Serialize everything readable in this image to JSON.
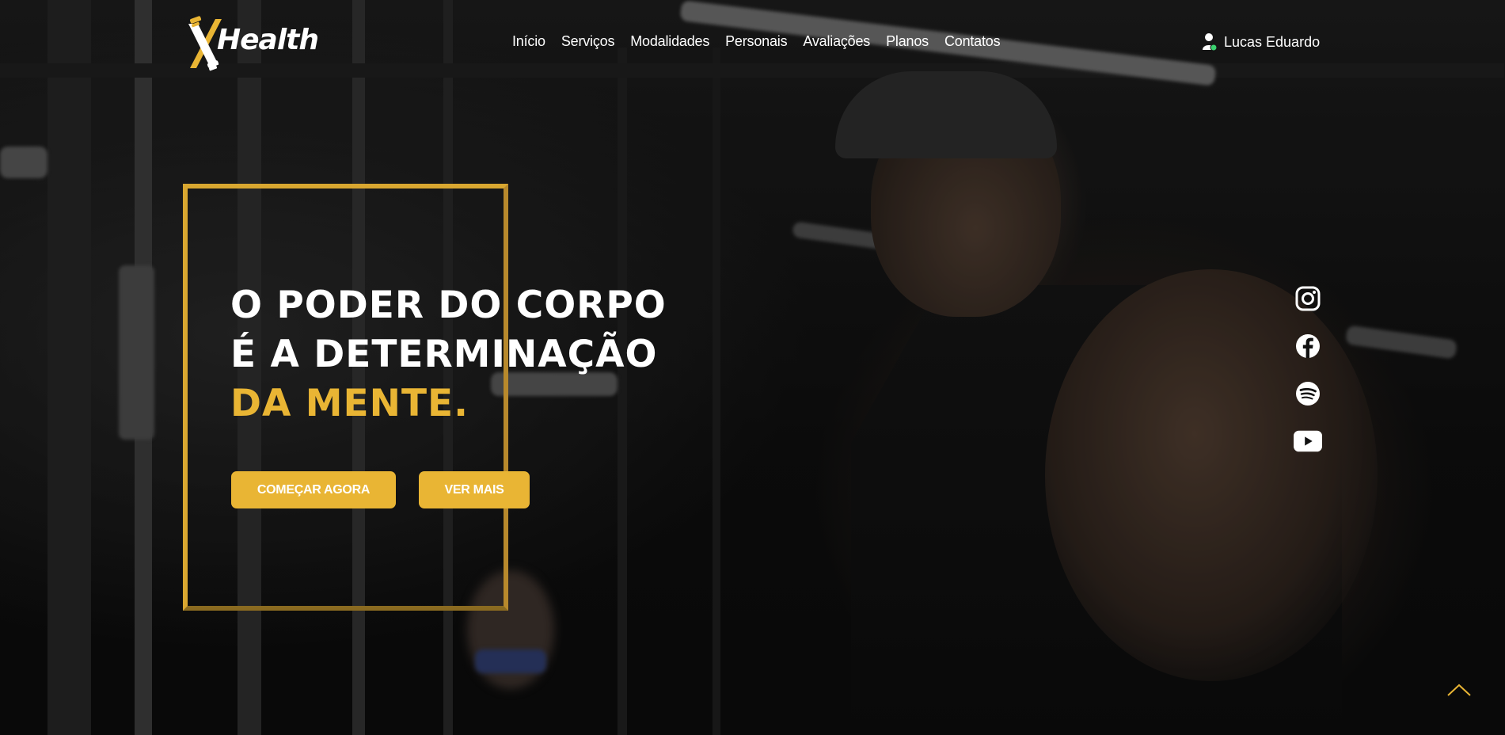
{
  "brand": {
    "name": "Health",
    "mark_letter": "X",
    "accent_color": "#e9b534"
  },
  "nav": {
    "items": [
      {
        "label": "Início"
      },
      {
        "label": "Serviços"
      },
      {
        "label": "Modalidades"
      },
      {
        "label": "Personais"
      },
      {
        "label": "Avaliações"
      },
      {
        "label": "Planos"
      },
      {
        "label": "Contatos"
      }
    ]
  },
  "user": {
    "name": "Lucas Eduardo",
    "icon": "user-icon",
    "status_color": "#3bd16f"
  },
  "hero": {
    "line1": "O PODER DO CORPO",
    "line2": "É A DETERMINAÇÃO",
    "line3": "DA MENTE.",
    "primary_button": "COMEÇAR AGORA",
    "secondary_button": "VER MAIS"
  },
  "social": [
    {
      "icon": "instagram-icon"
    },
    {
      "icon": "facebook-icon"
    },
    {
      "icon": "spotify-icon"
    },
    {
      "icon": "youtube-icon"
    }
  ],
  "scroll_top": {
    "icon": "chevron-up-icon"
  }
}
